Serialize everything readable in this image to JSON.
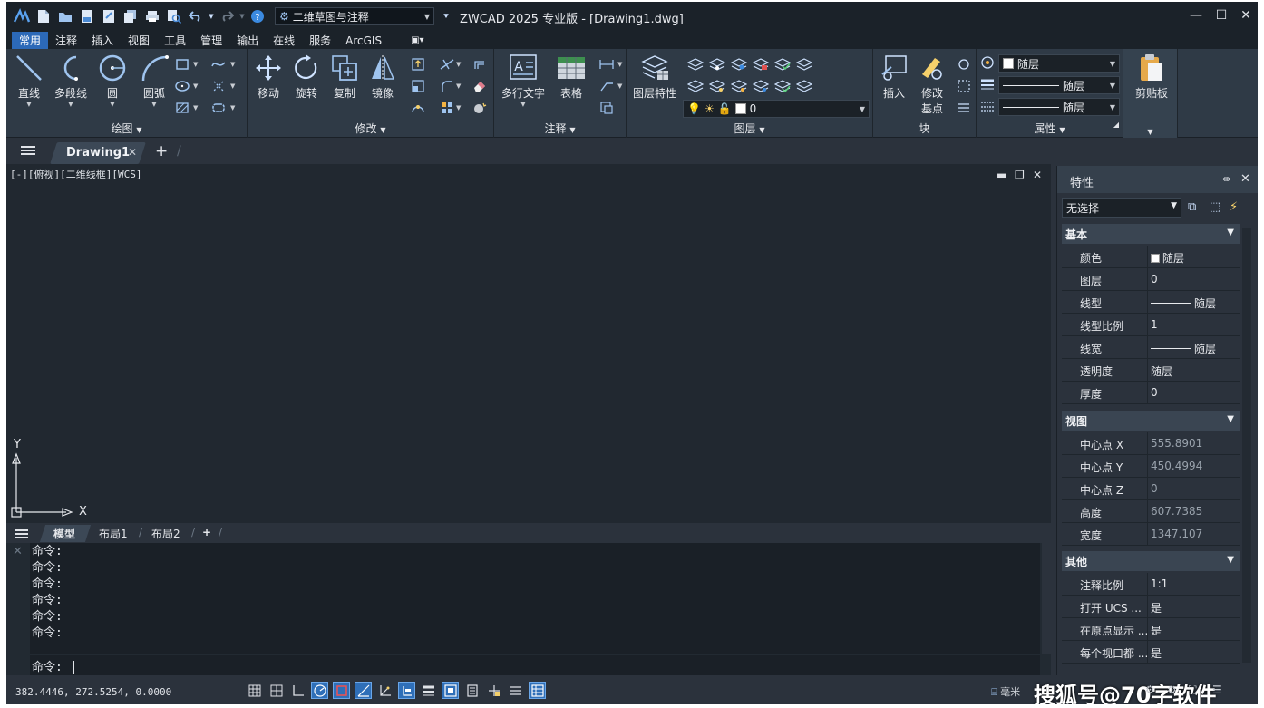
{
  "titlebar": {
    "workspace": "二维草图与注释",
    "title": "ZWCAD 2025 专业版 - [Drawing1.dwg]"
  },
  "menu_tabs": [
    "常用",
    "注释",
    "插入",
    "视图",
    "工具",
    "管理",
    "输出",
    "在线",
    "服务",
    "ArcGIS"
  ],
  "ribbon": {
    "draw": {
      "label": "绘图",
      "line": "直线",
      "polyline": "多段线",
      "circle": "圆",
      "arc": "圆弧"
    },
    "modify": {
      "label": "修改",
      "move": "移动",
      "rotate": "旋转",
      "copy": "复制",
      "mirror": "镜像"
    },
    "annotate": {
      "label": "注释",
      "mtext": "多行文字",
      "table": "表格"
    },
    "layers": {
      "label": "图层",
      "props": "图层特性",
      "current": "0"
    },
    "block": {
      "label": "块",
      "insert": "插入",
      "edit_base_1": "修改",
      "edit_base_2": "基点"
    },
    "properties": {
      "label": "属性",
      "color": "随层",
      "linetype": "随层",
      "lineweight": "随层"
    },
    "clipboard": {
      "label": "剪贴板"
    }
  },
  "doc_tab": "Drawing1",
  "viewport_label": "[-][俯视][二维线框][WCS]",
  "axis": {
    "x": "X",
    "y": "Y"
  },
  "layout_tabs": {
    "model": "模型",
    "layout1": "布局1",
    "layout2": "布局2"
  },
  "command": {
    "history": [
      "命令:",
      "命令:",
      "命令:",
      "命令:",
      "命令:",
      "命令:"
    ],
    "prompt": "命令:"
  },
  "status": {
    "coords": "382.4446, 272.5254, 0.0000",
    "units": "毫米"
  },
  "watermark": "搜狐号@70字软件",
  "properties": {
    "title": "特性",
    "selection": "无选择",
    "sections": {
      "general": "基本",
      "view": "视图",
      "misc": "其他"
    },
    "general_rows": [
      {
        "k": "颜色",
        "v": "随层"
      },
      {
        "k": "图层",
        "v": "0"
      },
      {
        "k": "线型",
        "v": "随层"
      },
      {
        "k": "线型比例",
        "v": "1"
      },
      {
        "k": "线宽",
        "v": "随层"
      },
      {
        "k": "透明度",
        "v": "随层"
      },
      {
        "k": "厚度",
        "v": "0"
      }
    ],
    "view_rows": [
      {
        "k": "中心点 X",
        "v": "555.8901"
      },
      {
        "k": "中心点 Y",
        "v": "450.4994"
      },
      {
        "k": "中心点 Z",
        "v": "0"
      },
      {
        "k": "高度",
        "v": "607.7385"
      },
      {
        "k": "宽度",
        "v": "1347.107"
      }
    ],
    "misc_rows": [
      {
        "k": "注释比例",
        "v": "1:1"
      },
      {
        "k": "打开 UCS ...",
        "v": "是"
      },
      {
        "k": "在原点显示 ...",
        "v": "是"
      },
      {
        "k": "每个视口都 ...",
        "v": "是"
      }
    ]
  }
}
